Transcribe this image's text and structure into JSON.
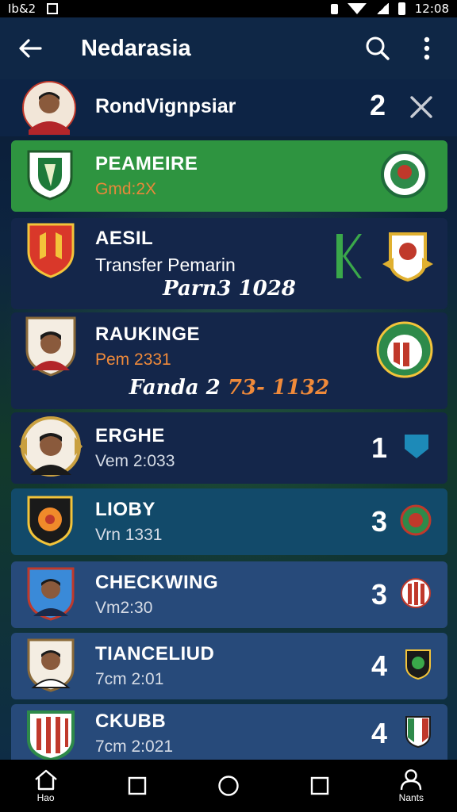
{
  "status_bar": {
    "left_text": "Ib&2",
    "time": "12:08"
  },
  "app_bar": {
    "title": "Nedarasia"
  },
  "header_row": {
    "name": "RondVignpsiar",
    "count": "2"
  },
  "rows": [
    {
      "name": "PEAMEIRE",
      "sub": "Gmd:2X",
      "count": "",
      "extra": "",
      "extra_orange": ""
    },
    {
      "name": "AESIL",
      "sub": "Transfer Pemarin",
      "count": "",
      "extra": "Parn3 1028",
      "extra_orange": ""
    },
    {
      "name": "RAUKINGE",
      "sub": "Pem 2331",
      "count": "",
      "extra": "Fanda 2 ",
      "extra_orange": "73- 1132"
    },
    {
      "name": "ERGHE",
      "sub": "Vem 2:033",
      "count": "1",
      "extra": "",
      "extra_orange": ""
    },
    {
      "name": "LIOBY",
      "sub": "Vrn 1331",
      "count": "3",
      "extra": "",
      "extra_orange": ""
    },
    {
      "name": "CHECKWING",
      "sub": "Vm2:30",
      "count": "3",
      "extra": "",
      "extra_orange": ""
    },
    {
      "name": "TIANCELIUD",
      "sub": "7cm 2:01",
      "count": "4",
      "extra": "",
      "extra_orange": ""
    },
    {
      "name": "CKUBB",
      "sub": "7cm 2:021",
      "count": "4",
      "extra": "",
      "extra_orange": ""
    }
  ],
  "bottom_nav": {
    "home_label": "Hao",
    "profile_label": "Nants"
  },
  "colors": {
    "accent_green": "#2e9440",
    "row_dark": "#14264a",
    "row_teal": "#124a6a",
    "row_blue": "#274a7a",
    "orange_text": "#f08a3a"
  }
}
